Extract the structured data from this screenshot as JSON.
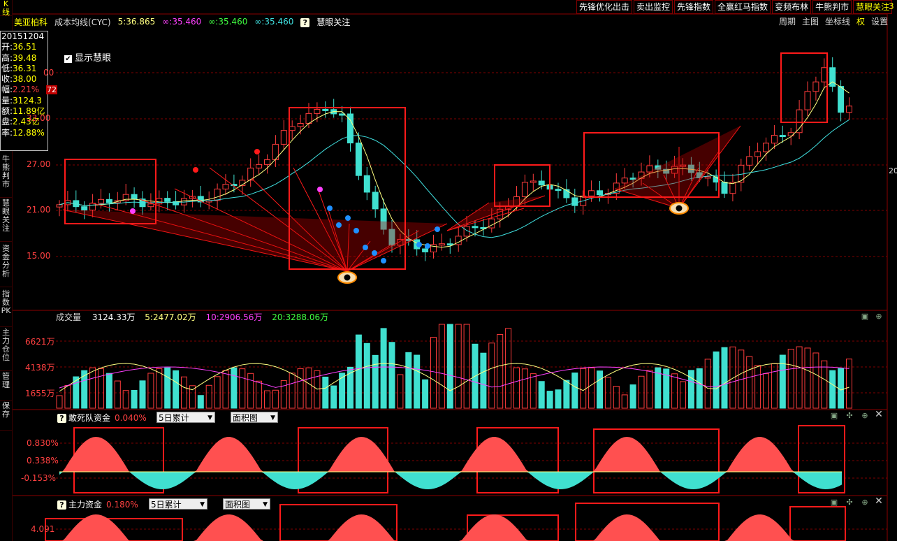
{
  "sidebar": {
    "tabs": [
      {
        "label": "K线"
      },
      {
        "label": "牛熊判市"
      },
      {
        "label": "慧眼关注"
      },
      {
        "label": "资金分析"
      },
      {
        "label": "指数PK"
      },
      {
        "label": "主力仓位"
      },
      {
        "label": "管理"
      },
      {
        "label": "保存"
      }
    ]
  },
  "topbar": {
    "buttons": [
      "先锋优化出击",
      "卖出监控",
      "先锋指数",
      "全赢红马指数",
      "变频布林",
      "牛熊判市",
      "慧眼关注"
    ],
    "active_index": 6,
    "corner": "3"
  },
  "title": {
    "stock_name": "美亚柏科",
    "indicator": "成本均线(CYC)",
    "ma5": "5:36.865",
    "ma_inf1": "∞:35.460",
    "ma_inf2": "∞:35.460",
    "ma_inf3": "∞:35.460",
    "help": "?",
    "focus": "慧眼关注"
  },
  "rightmenu": [
    "周期",
    "主图",
    "坐标线",
    "权",
    "设置"
  ],
  "checkbox": {
    "label": "显示慧眼",
    "checked": "✔"
  },
  "info": {
    "date": "20151204",
    "rows": [
      {
        "k": "开:",
        "v": "36.51"
      },
      {
        "k": "高:",
        "v": "39.48"
      },
      {
        "k": "低:",
        "v": "36.31"
      },
      {
        "k": "收:",
        "v": "38.00"
      },
      {
        "k": "幅:",
        "v": "2.21%"
      },
      {
        "k": "量:",
        "v": "3124.3"
      },
      {
        "k": "额:",
        "v": "11.89亿"
      },
      {
        "k": "盘:",
        "v": "2.43亿"
      },
      {
        "k": "率:",
        "v": "12.88%"
      }
    ]
  },
  "price_axis": {
    "labels": [
      "33.00",
      "27.00",
      "21.00",
      "15.00"
    ],
    "partial_top": "00",
    "cut_tag": "72",
    "right_label": "20"
  },
  "volume": {
    "title": "成交量",
    "value": "3124.33万",
    "ma5": "5:2477.02万",
    "ma10": "10:2906.56万",
    "ma20": "20:3288.06万",
    "axis": [
      "6621万",
      "4138万",
      "1655万"
    ]
  },
  "panel1": {
    "help": "?",
    "title": "敢死队资金",
    "value": "0.040%",
    "select1": "5日累计",
    "select2": "面积图",
    "axis": [
      "0.830%",
      "0.338%",
      "-0.153%"
    ]
  },
  "panel2": {
    "help": "?",
    "title": "主力资金",
    "value": "0.180%",
    "select1": "5日累计",
    "select2": "面积图",
    "axis": [
      "4.091"
    ]
  },
  "colors": {
    "up": "#ff3c3c",
    "down": "#40e0d0",
    "highlight": "#ff1a1a",
    "ma5": "#ffff80",
    "ma_magenta": "#ff40ff",
    "ma_green": "#40ff40",
    "ma_cyan": "#40e0e0"
  },
  "icons": [
    "eye-icon",
    "help-icon",
    "checkbox-icon",
    "dropdown-arrow-icon",
    "close-icon",
    "zoom-icon",
    "settings-icon"
  ]
}
